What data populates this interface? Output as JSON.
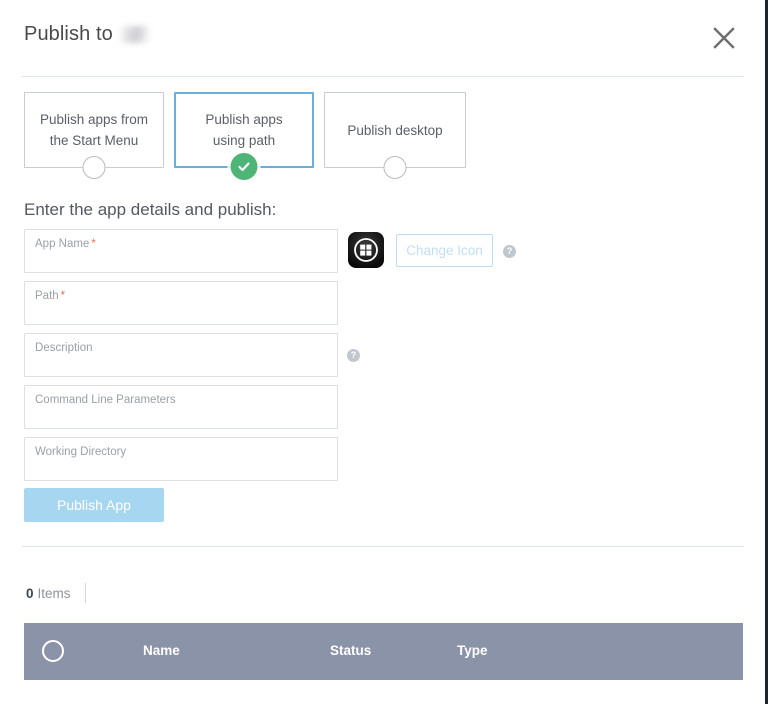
{
  "dialog": {
    "title_prefix": "Publish to",
    "title_redacted": true,
    "close_icon": "close-icon"
  },
  "options": {
    "cards": [
      {
        "label": "Publish apps from\nthe Start Menu",
        "selected": false
      },
      {
        "label": "Publish apps\nusing path",
        "selected": true
      },
      {
        "label": "Publish desktop",
        "selected": false
      }
    ]
  },
  "form": {
    "section_title": "Enter the app details and publish:",
    "fields": [
      {
        "placeholder": "App Name",
        "value": "",
        "required": true
      },
      {
        "placeholder": "Path",
        "value": "",
        "required": true
      },
      {
        "placeholder": "Description",
        "value": "",
        "required": false
      },
      {
        "placeholder": "Command Line Parameters",
        "value": "",
        "required": false
      },
      {
        "placeholder": "Working Directory",
        "value": "",
        "required": false
      }
    ],
    "required_marker": "*",
    "app_icon": "windows-app-icon",
    "change_icon_label": "Change Icon",
    "help_glyph": "?",
    "publish_label": "Publish App"
  },
  "list": {
    "count": "0",
    "count_label": "Items",
    "select_all_icon": "radio-circle-icon",
    "columns": [
      "Name",
      "Status",
      "Type"
    ],
    "rows": []
  },
  "colors": {
    "accent_blue": "#6aaede",
    "check_green": "#4fb477",
    "table_header": "#8b93a9",
    "button_disabled": "#a7d6f0",
    "required_red": "#e8705a",
    "divider": "#dde7ec"
  }
}
